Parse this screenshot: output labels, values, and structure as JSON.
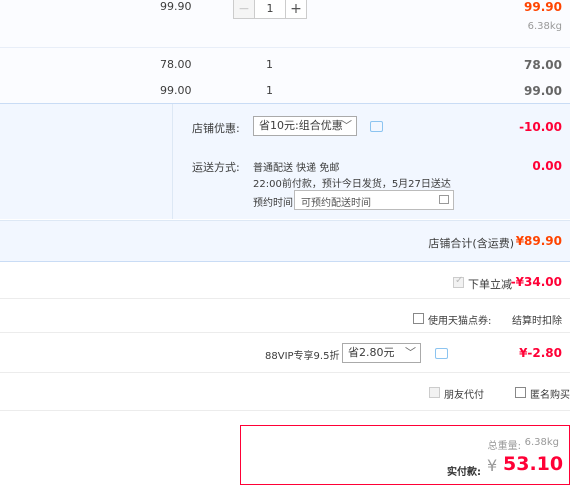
{
  "items": [
    {
      "unit_price": "99.90",
      "quantity": "1",
      "subtotal": "99.90",
      "weight": "6.38kg"
    },
    {
      "unit_price": "78.00",
      "quantity": "1",
      "subtotal": "78.00"
    },
    {
      "unit_price": "99.00",
      "quantity": "1",
      "subtotal": "99.00"
    }
  ],
  "shop_discount": {
    "label": "店铺优惠:",
    "selected": "省10元:组合优惠",
    "amount": "-10.00"
  },
  "shipping": {
    "label": "运送方式:",
    "method": "普通配送 快递 免邮",
    "note": "22:00前付款，预计今日发货，5月27日送达",
    "appointment_label": "预约时间",
    "appointment_placeholder": "可预约配送时间",
    "fee": "0.00"
  },
  "shop_total": {
    "label": "店铺合计(含运费)",
    "amount": "¥89.90"
  },
  "instant_discount": {
    "label": "下单立减",
    "amount": "-¥34.00"
  },
  "tmall_points": {
    "label": "使用天猫点券:",
    "note": "结算时扣除"
  },
  "vip": {
    "label": "88VIP专享9.5折",
    "selected": "省2.80元",
    "amount": "¥-2.80"
  },
  "options": {
    "friend_pay": "朋友代付",
    "anonymous": "匿名购买"
  },
  "summary": {
    "weight_label": "总重量:",
    "weight": "6.38kg",
    "pay_label": "实付款:",
    "currency": "¥",
    "amount": "53.10"
  },
  "colors": {
    "accent": "#ff0036",
    "orange": "#ff4400",
    "highlight_bg": "#f2f7ff",
    "panel_bg": "#fbfcff"
  }
}
